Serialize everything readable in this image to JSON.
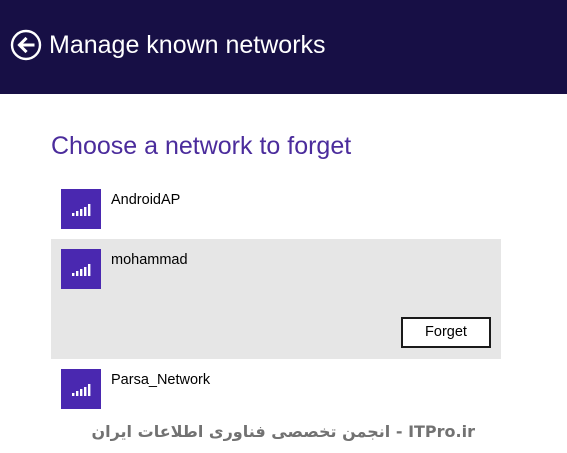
{
  "header": {
    "title": "Manage known networks",
    "back_icon": "back-arrow-circle-icon"
  },
  "section": {
    "title": "Choose a network to forget"
  },
  "networks": [
    {
      "name": "AndroidAP",
      "icon": "wifi-signal-icon",
      "signal_bars": 5,
      "selected": false
    },
    {
      "name": "mohammad",
      "icon": "wifi-signal-icon",
      "signal_bars": 5,
      "selected": true
    },
    {
      "name": "Parsa_Network",
      "icon": "wifi-signal-icon",
      "signal_bars": 5,
      "selected": false
    }
  ],
  "actions": {
    "forget_label": "Forget"
  },
  "watermark": {
    "text": "ITPro.ir - انجمن تخصصی فناوری اطلاعات ایران"
  },
  "colors": {
    "header_bg": "#170f45",
    "accent_title": "#4b2c9c",
    "tile": "#4a28b0",
    "selected_bg": "#e6e6e6"
  }
}
